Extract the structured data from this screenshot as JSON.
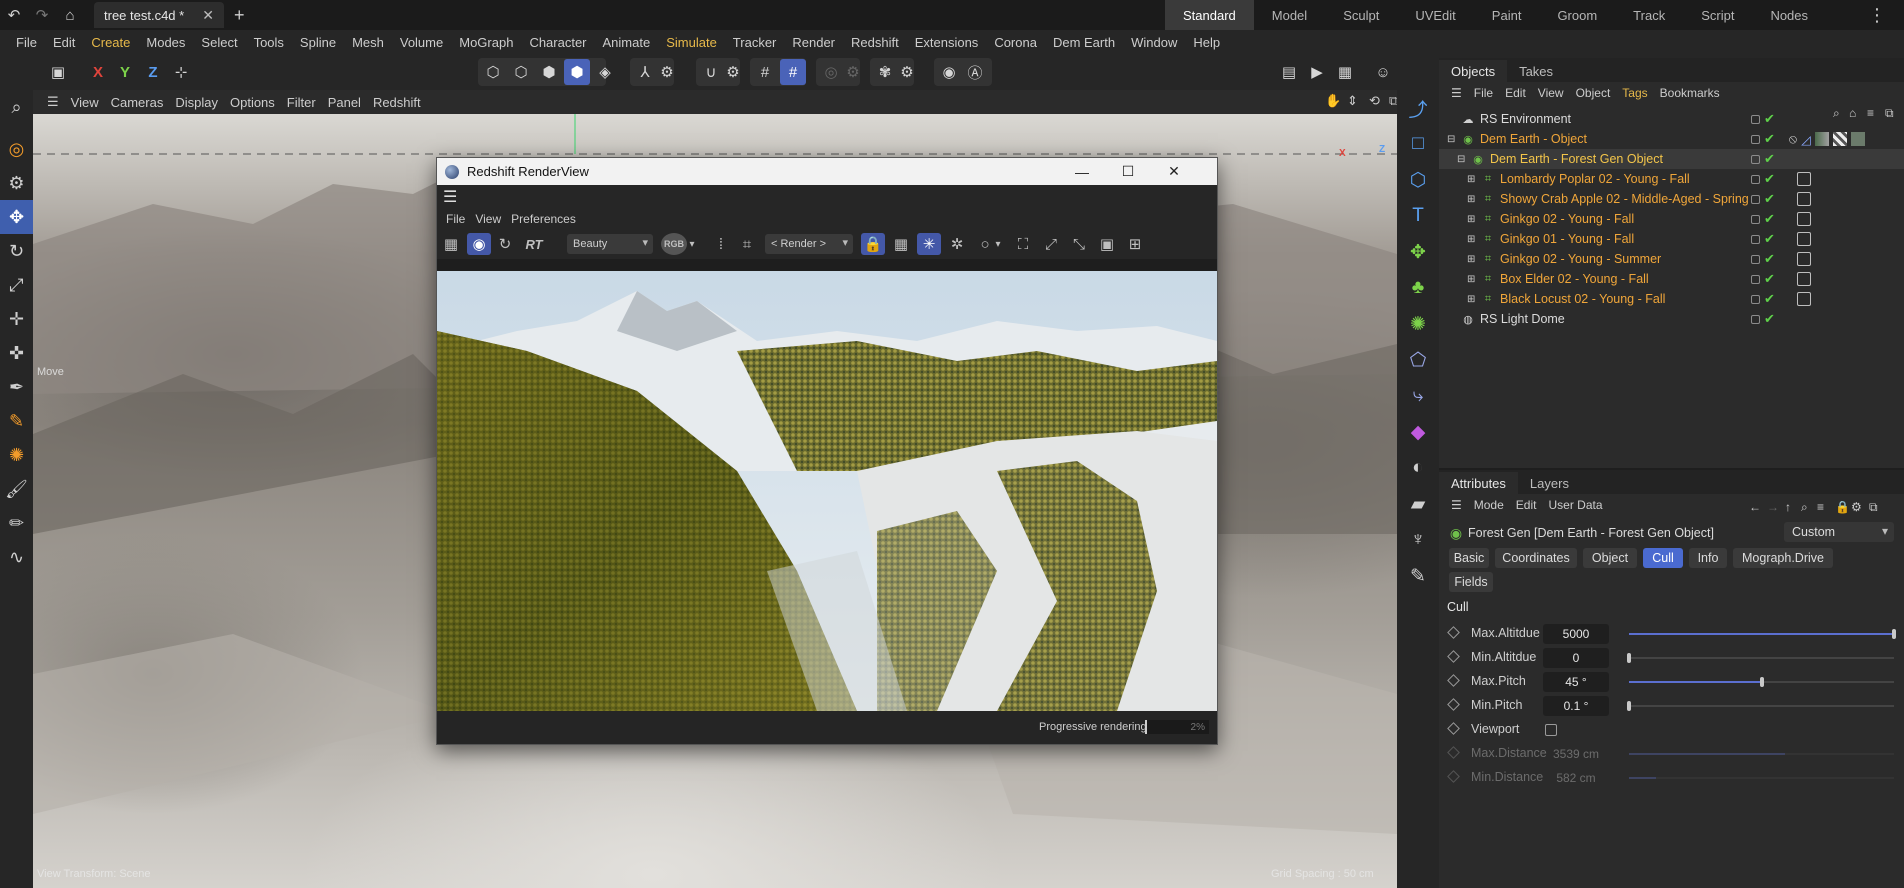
{
  "titlebar": {
    "doc_tab": "tree test.c4d *",
    "layouts": [
      "Standard",
      "Model",
      "Sculpt",
      "UVEdit",
      "Paint",
      "Groom",
      "Track",
      "Script",
      "Nodes"
    ]
  },
  "menu": [
    "File",
    "Edit",
    "Create",
    "Modes",
    "Select",
    "Tools",
    "Spline",
    "Mesh",
    "Volume",
    "MoGraph",
    "Character",
    "Animate",
    "Simulate",
    "Tracker",
    "Render",
    "Redshift",
    "Extensions",
    "Corona",
    "Dem Earth",
    "Window",
    "Help"
  ],
  "toolbar": {
    "axis_x": "X",
    "axis_y": "Y",
    "axis_z": "Z"
  },
  "viewport": {
    "menu": [
      "View",
      "Cameras",
      "Display",
      "Options",
      "Filter",
      "Panel",
      "Redshift"
    ],
    "hud_view_transform": "View Transform: Scene",
    "hud_grid_spacing": "Grid Spacing : 50 cm",
    "hud_move": "Move",
    "axis_x": "X",
    "axis_z": "Z"
  },
  "objects_panel": {
    "tabs": [
      "Objects",
      "Takes"
    ],
    "menu": [
      "File",
      "Edit",
      "View",
      "Object",
      "Tags",
      "Bookmarks"
    ],
    "rows": [
      {
        "name": "RS Environment"
      },
      {
        "name": "Dem Earth - Object"
      },
      {
        "name": "Dem Earth - Forest Gen Object"
      },
      {
        "name": "Lombardy Poplar 02 - Young - Fall"
      },
      {
        "name": "Showy Crab Apple 02 - Middle-Aged - Spring"
      },
      {
        "name": "Ginkgo 02 - Young - Fall"
      },
      {
        "name": "Ginkgo 01 - Young - Fall"
      },
      {
        "name": "Ginkgo 02 - Young - Summer"
      },
      {
        "name": "Box Elder 02 - Young - Fall"
      },
      {
        "name": "Black Locust 02 - Young - Fall"
      },
      {
        "name": "RS Light Dome"
      }
    ]
  },
  "attributes_panel": {
    "tabs": [
      "Attributes",
      "Layers"
    ],
    "menu": [
      "Mode",
      "Edit",
      "User Data"
    ],
    "object_title": "Forest Gen [Dem Earth - Forest Gen Object]",
    "preset": "Custom",
    "sub_tabs": [
      "Basic",
      "Coordinates",
      "Object",
      "Cull",
      "Info",
      "Mograph.Drive",
      "Fields"
    ],
    "section": "Cull",
    "params": [
      {
        "label": "Max.Altitdue",
        "value": "5000",
        "fraction": 1.0
      },
      {
        "label": "Min.Altitdue",
        "value": "0",
        "fraction": 0.0
      },
      {
        "label": "Max.Pitch",
        "value": "45 °",
        "fraction": 0.5
      },
      {
        "label": "Min.Pitch",
        "value": "0.1 °",
        "fraction": 0.0
      },
      {
        "label": "Viewport",
        "value": ""
      },
      {
        "label": "Max.Distance",
        "value": "3539 cm",
        "fraction": 0.59
      },
      {
        "label": "Min.Distance",
        "value": "582 cm",
        "fraction": 0.1
      }
    ]
  },
  "renderview": {
    "title": "Redshift RenderView",
    "menu": [
      "File",
      "View",
      "Preferences"
    ],
    "aov_select": "Beauty",
    "rt_label": "RT",
    "rgb_label": "RGB",
    "camera_select": "< Render >",
    "status_text": "Progressive rendering",
    "progress_text": "2%",
    "progress": 0.02
  },
  "colors": {
    "accent": "#4a6ad0",
    "highlight": "#e7b94a",
    "orange_item": "#f0a63a",
    "check_green": "#5fd14a"
  }
}
